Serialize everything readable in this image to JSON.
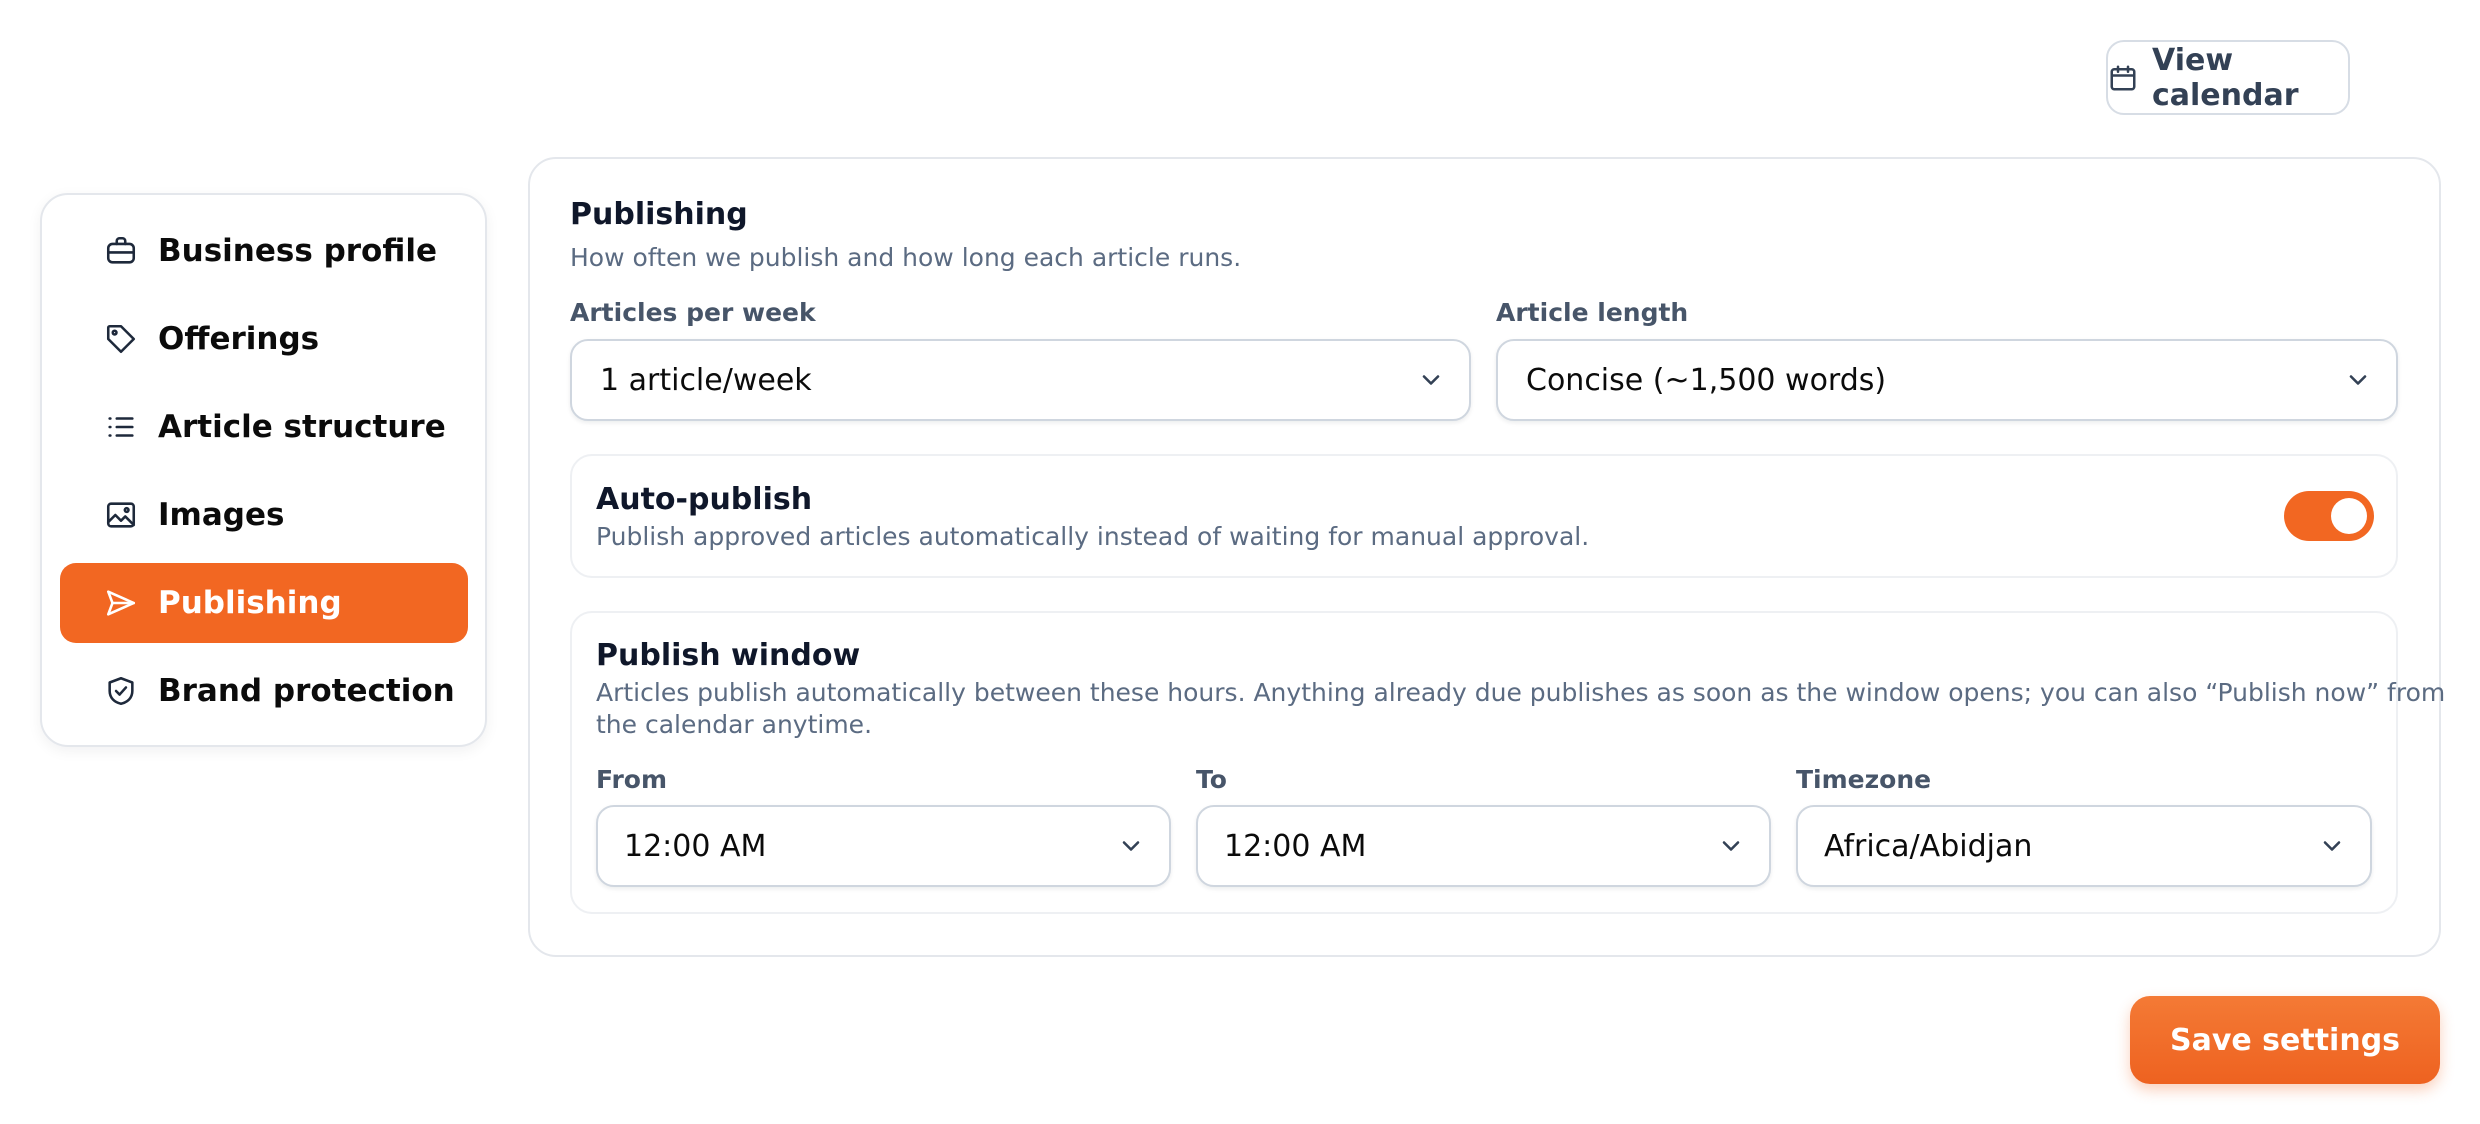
{
  "header": {
    "view_calendar_label": "View calendar"
  },
  "sidebar": {
    "items": [
      {
        "label": "Business profile",
        "icon": "briefcase-icon"
      },
      {
        "label": "Offerings",
        "icon": "tag-icon"
      },
      {
        "label": "Article structure",
        "icon": "list-icon"
      },
      {
        "label": "Images",
        "icon": "image-icon"
      },
      {
        "label": "Publishing",
        "icon": "send-icon",
        "active": true
      },
      {
        "label": "Brand protection",
        "icon": "shield-check-icon"
      }
    ]
  },
  "publishing": {
    "title": "Publishing",
    "subtitle": "How often we publish and how long each article runs.",
    "articles_per_week": {
      "label": "Articles per week",
      "value": "1 article/week"
    },
    "article_length": {
      "label": "Article length",
      "value": "Concise (~1,500 words)"
    }
  },
  "auto_publish": {
    "title": "Auto-publish",
    "description": "Publish approved articles automatically instead of waiting for manual approval.",
    "enabled": true
  },
  "publish_window": {
    "title": "Publish window",
    "description_line1": "Articles publish automatically between these hours. Anything already due publishes as soon as the window opens; you can also “Publish now” from",
    "description_line2": "the calendar anytime.",
    "from": {
      "label": "From",
      "value": "12:00 AM"
    },
    "to": {
      "label": "To",
      "value": "12:00 AM"
    },
    "timezone": {
      "label": "Timezone",
      "value": "Africa/Abidjan"
    }
  },
  "footer": {
    "save_label": "Save settings"
  },
  "colors": {
    "accent": "#f26722",
    "text": "#0f172a",
    "muted": "#5b6b82",
    "border": "#cfd6df"
  }
}
